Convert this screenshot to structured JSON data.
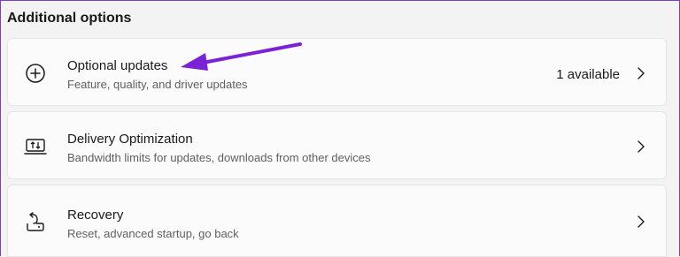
{
  "section": {
    "title": "Additional options"
  },
  "options": [
    {
      "title": "Optional updates",
      "subtitle": "Feature, quality, and driver updates",
      "status": "1 available",
      "icon": "plus-circle-icon"
    },
    {
      "title": "Delivery Optimization",
      "subtitle": "Bandwidth limits for updates, downloads from other devices",
      "icon": "delivery-optimization-icon"
    },
    {
      "title": "Recovery",
      "subtitle": "Reset, advanced startup, go back",
      "icon": "recovery-icon"
    }
  ],
  "colors": {
    "annotation_arrow": "#7b22d6",
    "card_background": "#fbfbfb",
    "page_background": "#f3f3f3",
    "subtitle_text": "#5f5f5f"
  }
}
